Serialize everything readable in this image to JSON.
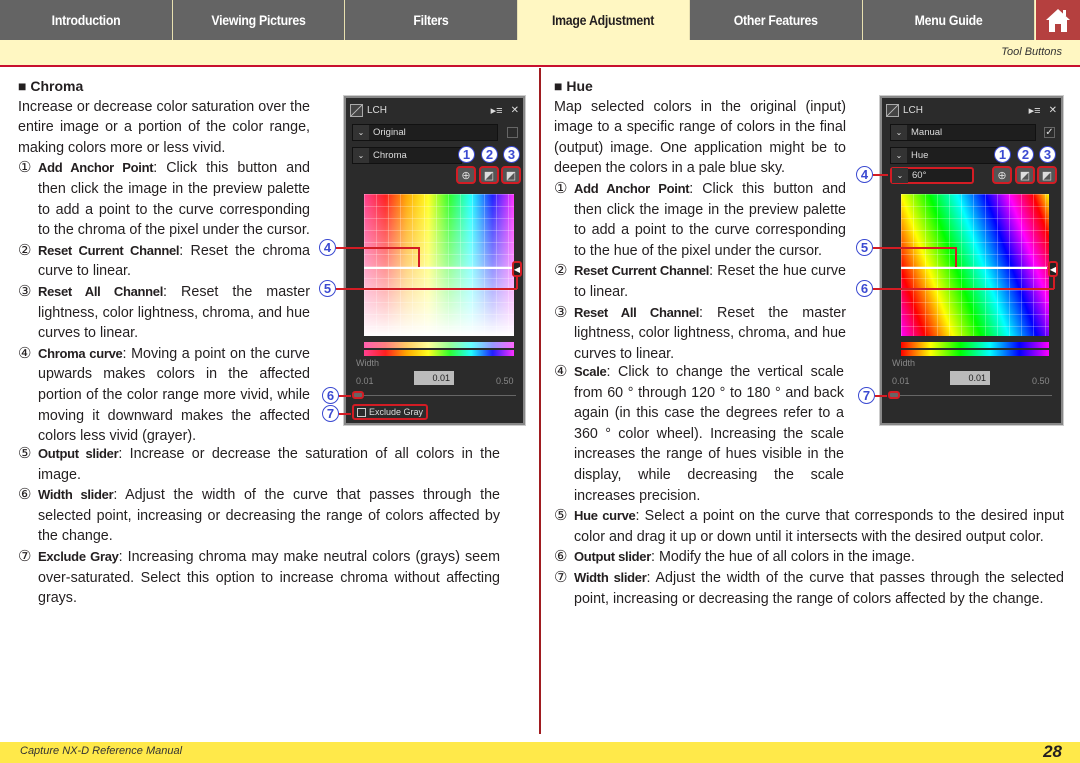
{
  "nav": {
    "tabs": [
      {
        "label": "Introduction",
        "active": false
      },
      {
        "label": "Viewing Pictures",
        "active": false
      },
      {
        "label": "Filters",
        "active": false
      },
      {
        "label": "Image Adjustment",
        "active": true
      },
      {
        "label": "Other Features",
        "active": false
      },
      {
        "label": "Menu Guide",
        "active": false
      }
    ],
    "home_icon": "home-icon",
    "tool_buttons_link": "Tool Buttons"
  },
  "chroma": {
    "heading": "■ Chroma",
    "intro": "Increase or decrease color saturation over the entire image or a portion of the color range, making colors more or less vivid.",
    "items": [
      {
        "num": "①",
        "term": "Add Anchor Point",
        "text": ": Click this button and then click the image in the preview palette to add a point to the curve corresponding to the chroma of the pixel under the cursor."
      },
      {
        "num": "②",
        "term": "Reset Current Channel",
        "text": ": Reset the chroma curve to linear."
      },
      {
        "num": "③",
        "term": "Reset All Channel",
        "text": ": Reset the master lightness, color lightness, chroma, and hue curves to linear."
      },
      {
        "num": "④",
        "term": "Chroma curve",
        "text": ": Moving a point on the curve upwards makes colors in the affected portion of the color range more vivid, while moving it downward makes the affected colors less vivid (grayer)."
      },
      {
        "num": "⑤",
        "term": "Output slider",
        "text": ": Increase or decrease the saturation of all colors in the image."
      },
      {
        "num": "⑥",
        "term": "Width slider",
        "text": ": Adjust the width of the curve that passes through the selected point, increasing or decreasing the range of colors affected by the change."
      },
      {
        "num": "⑦",
        "term": "Exclude Gray",
        "text": ": Increasing chroma may make neutral colors (grays) seem over-saturated.  Select this option to increase chroma without affecting grays."
      }
    ],
    "panel": {
      "title": "LCH",
      "menu_icon": "▸≡",
      "close_icon": "✕",
      "dropdown1": "Original",
      "dropdown2": "Chroma",
      "width_label": "Width",
      "width_min": "0.01",
      "width_value": "0.01",
      "width_max": "0.50",
      "exclude_gray": "Exclude Gray",
      "callouts": [
        "1",
        "2",
        "3",
        "4",
        "5",
        "6",
        "7"
      ]
    }
  },
  "hue": {
    "heading": "■ Hue",
    "intro": "Map selected colors in the original (input) image to a specific range of colors in the final (output) image.  One application might be to deepen the colors in a pale blue sky.",
    "items": [
      {
        "num": "①",
        "term": "Add Anchor Point",
        "text": ": Click this button and then click the image in the preview palette to add a point to the curve corresponding to the hue of the pixel under the cursor."
      },
      {
        "num": "②",
        "term": "Reset Current Channel",
        "text": ": Reset the hue curve to linear."
      },
      {
        "num": "③",
        "term": "Reset All Channel",
        "text": ": Reset the master lightness, color lightness, chroma, and hue curves to linear."
      },
      {
        "num": "④",
        "term": "Scale",
        "text": ": Click to change the vertical scale from 60 ° through 120 ° to 180 ° and back again (in this case the degrees refer to a 360 ° color wheel).  Increasing the scale increases the range of hues visible in the display, while decreasing the scale increases precision."
      },
      {
        "num": "⑤",
        "term": "Hue curve",
        "text": ": Select a point on the curve that corresponds to the desired input color and drag it up or down until it intersects with the desired output color."
      },
      {
        "num": "⑥",
        "term": "Output slider",
        "text": ": Modify the hue of all colors in the image."
      },
      {
        "num": "⑦",
        "term": "Width slider",
        "text": ": Adjust the width of the curve that passes through the selected point, increasing or decreasing the range of colors affected by the change."
      }
    ],
    "panel": {
      "title": "LCH",
      "menu_icon": "▸≡",
      "close_icon": "✕",
      "dropdown1": "Manual",
      "dropdown2": "Hue",
      "dropdown3": "60°",
      "width_label": "Width",
      "width_min": "0.01",
      "width_value": "0.01",
      "width_max": "0.50",
      "callouts": [
        "1",
        "2",
        "3",
        "4",
        "5",
        "6",
        "7"
      ]
    }
  },
  "footer": {
    "title": "Capture NX-D Reference Manual",
    "page": "28"
  }
}
